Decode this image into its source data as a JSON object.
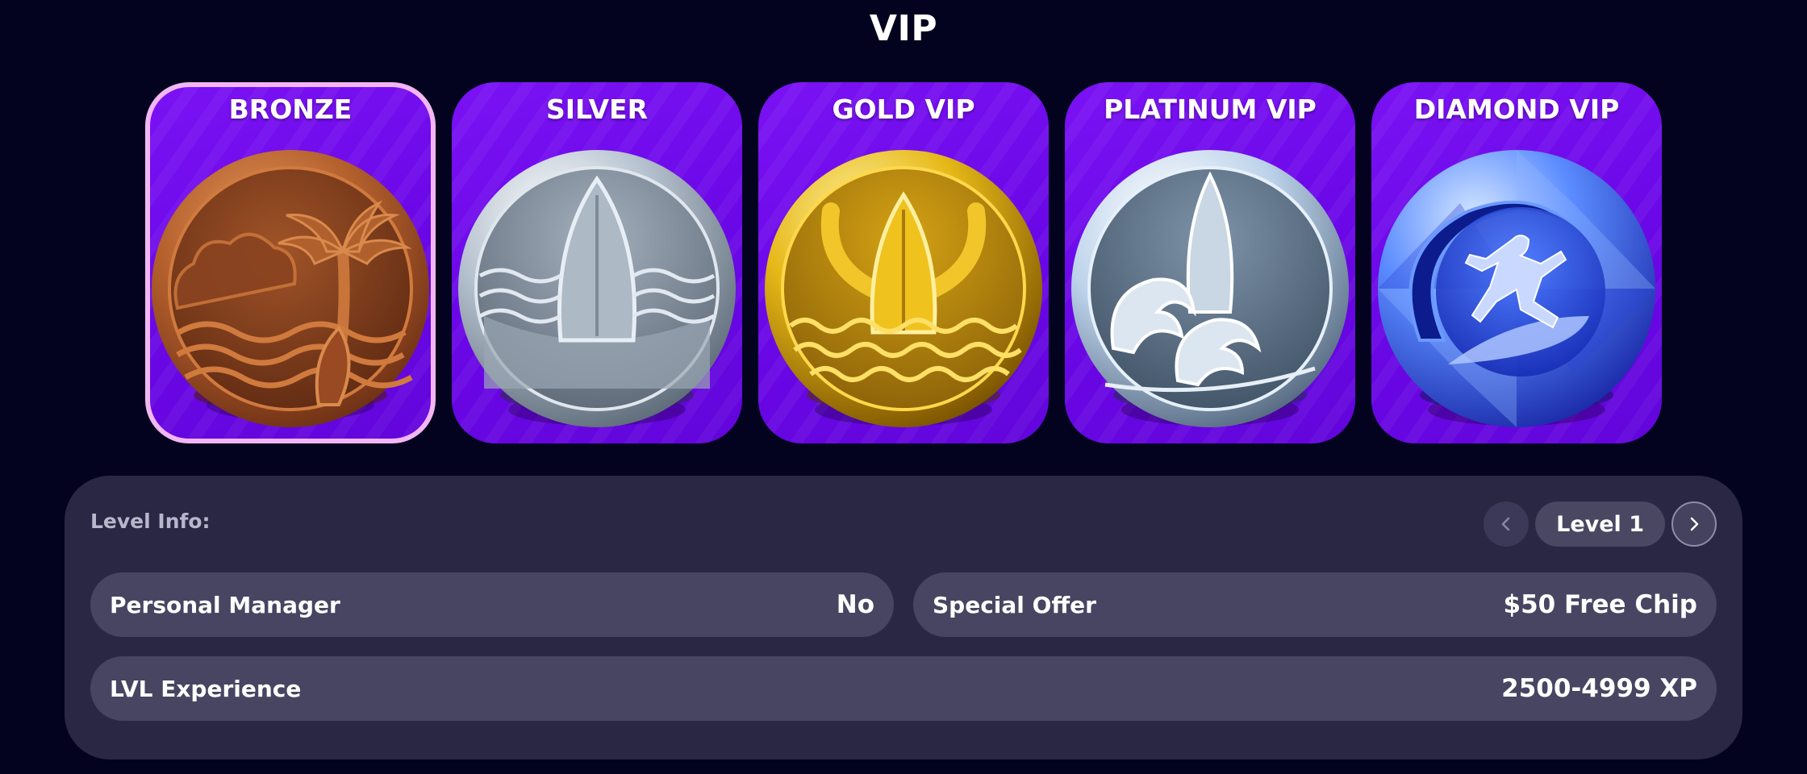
{
  "page": {
    "title": "VIP"
  },
  "tiers": [
    {
      "name": "BRONZE",
      "icon": "bronze-palm-beach-medal-icon",
      "selected": true,
      "colors": {
        "rim": "#b4602d",
        "face": "#7a3c1e"
      }
    },
    {
      "name": "SILVER",
      "icon": "silver-surfboard-waves-medal-icon",
      "selected": false,
      "colors": {
        "rim": "#c3cfdc",
        "face": "#7f8c99"
      }
    },
    {
      "name": "GOLD VIP",
      "icon": "gold-surfboard-waves-medal-icon",
      "selected": false,
      "colors": {
        "rim": "#e6b818",
        "face": "#b8860b"
      }
    },
    {
      "name": "PLATINUM VIP",
      "icon": "platinum-wave-surfboard-medal-icon",
      "selected": false,
      "colors": {
        "rim": "#d7e6f5",
        "face": "#5e7389"
      }
    },
    {
      "name": "DIAMOND VIP",
      "icon": "diamond-surfer-medal-icon",
      "selected": false,
      "colors": {
        "rim": "#6aa2ff",
        "face": "#1730c8"
      }
    }
  ],
  "level_info": {
    "label": "Level Info:",
    "level": "Level 1",
    "prev_icon": "chevron-left-icon",
    "next_icon": "chevron-right-icon",
    "rows": {
      "personal_manager": {
        "label": "Personal Manager",
        "value": "No"
      },
      "special_offer": {
        "label": "Special Offer",
        "value": "$50 Free Chip"
      },
      "lvl_experience": {
        "label": "LVL Experience",
        "value": "2500-4999 XP"
      }
    }
  },
  "colors": {
    "background": "#03031f",
    "card_purple": "#6a07e6",
    "selected_border": "#f3b6f5",
    "panel": "#2a2745",
    "row": "#474561"
  }
}
